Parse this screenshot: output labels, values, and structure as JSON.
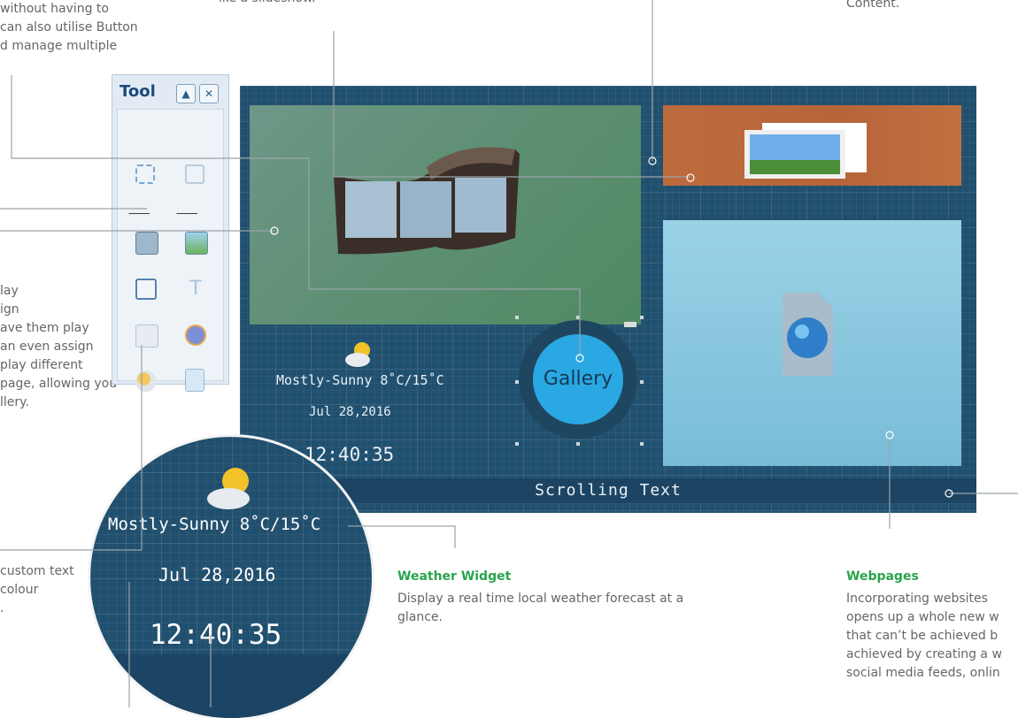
{
  "captions": {
    "top_left_lines": [
      "without having to",
      "can also utilise Button",
      "d manage multiple"
    ],
    "top_mid": "ike a slideshow.",
    "top_right": "Content.",
    "left_mid_lines": [
      "lay",
      "ign",
      "ave them play",
      "an even assign",
      "play different",
      "page, allowing you",
      "llery."
    ],
    "left_low_lines": [
      "custom text",
      "colour",
      "."
    ]
  },
  "weather_widget": {
    "title": "Weather Widget",
    "desc_lines": [
      "Display a real time local weather forecast at a",
      "glance."
    ]
  },
  "webpages": {
    "title": "Webpages",
    "desc_lines": [
      "Incorporating websites",
      "opens up a whole new w",
      "that can’t be achieved b",
      "achieved by creating a w",
      "social media feeds, onlin"
    ]
  },
  "tool_panel": {
    "title": "Tool",
    "up_btn": "▲",
    "close_btn": "✕",
    "dashes": [
      "-------",
      "-------"
    ],
    "icons": [
      "select-region-icon",
      "zoom-region-icon",
      "video-icon",
      "image-icon",
      "weather-icon",
      "text-icon",
      "calendar-icon",
      "clock-icon",
      "cloud-icon",
      "document-icon"
    ]
  },
  "screen": {
    "weather": "Mostly-Sunny 8˚C/15˚C",
    "date": "Jul 28,2016",
    "time": "12:40:35",
    "gallery": "Gallery",
    "scrolling": "Scrolling Text"
  },
  "zoom": {
    "weather": "Mostly-Sunny 8˚C/15˚C",
    "date": "Jul 28,2016",
    "time": "12:40:35"
  }
}
